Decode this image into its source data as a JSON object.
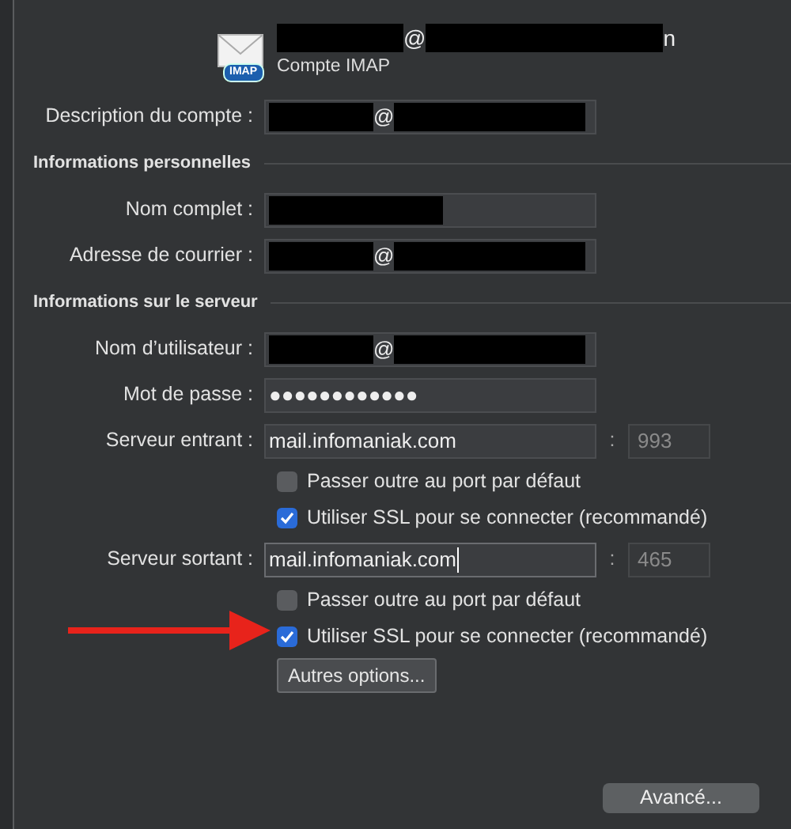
{
  "header": {
    "icon_badge": "IMAP",
    "title": [
      {
        "kind": "redacted"
      },
      {
        "kind": "text",
        "text": "@"
      },
      {
        "kind": "redacted"
      },
      {
        "kind": "text",
        "text": "n"
      }
    ],
    "subtitle": "Compte IMAP"
  },
  "account": {
    "label": "Description du compte :",
    "value": [
      {
        "kind": "redacted"
      },
      {
        "kind": "text",
        "text": "@"
      },
      {
        "kind": "redacted"
      }
    ]
  },
  "sections": [
    {
      "title": "Informations personnelles",
      "fields": [
        {
          "label": "Nom complet :",
          "value": [
            {
              "kind": "redacted"
            }
          ]
        },
        {
          "label": "Adresse de courrier :",
          "value": [
            {
              "kind": "redacted"
            },
            {
              "kind": "text",
              "text": "@"
            },
            {
              "kind": "redacted"
            }
          ]
        }
      ]
    },
    {
      "title": "Informations sur le serveur",
      "fields": [
        {
          "label": "Nom d’utilisateur :",
          "value": [
            {
              "kind": "redacted"
            },
            {
              "kind": "text",
              "text": "@"
            },
            {
              "kind": "redacted"
            }
          ]
        },
        {
          "label": "Mot de passe :",
          "value": [
            {
              "kind": "text",
              "text": "●●●●●●●●●●●●"
            }
          ]
        }
      ]
    }
  ],
  "servers": [
    {
      "label": "Serveur entrant :",
      "host": "mail.infomaniak.com",
      "separator": ":",
      "port": "993",
      "focused": false,
      "options": [
        {
          "label": "Passer outre au port par défaut",
          "checked": false
        },
        {
          "label": "Utiliser SSL pour se connecter (recommandé)",
          "checked": true
        }
      ]
    },
    {
      "label": "Serveur sortant :",
      "host": "mail.infomaniak.com",
      "separator": ":",
      "port": "465",
      "focused": true,
      "options": [
        {
          "label": "Passer outre au port par défaut",
          "checked": false
        },
        {
          "label": "Utiliser SSL pour se connecter (recommandé)",
          "checked": true,
          "highlighted": true
        }
      ]
    }
  ],
  "more_button": "Autres options...",
  "advanced_button": "Avancé..."
}
